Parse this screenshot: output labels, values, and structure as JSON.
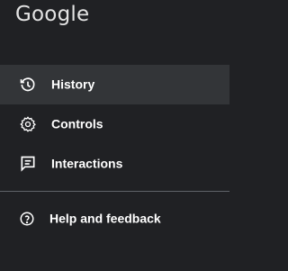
{
  "brand": {
    "logo_text": "Google"
  },
  "nav": {
    "items": [
      {
        "label": "History",
        "icon": "history-icon",
        "active": true
      },
      {
        "label": "Controls",
        "icon": "gear-icon",
        "active": false
      },
      {
        "label": "Interactions",
        "icon": "feedback-list-icon",
        "active": false
      }
    ]
  },
  "footer": {
    "help_label": "Help and feedback",
    "help_icon": "help-circle-icon"
  },
  "colors": {
    "background": "#202124",
    "active_item": "#333538",
    "text": "#ffffff",
    "divider": "#5f6368"
  }
}
